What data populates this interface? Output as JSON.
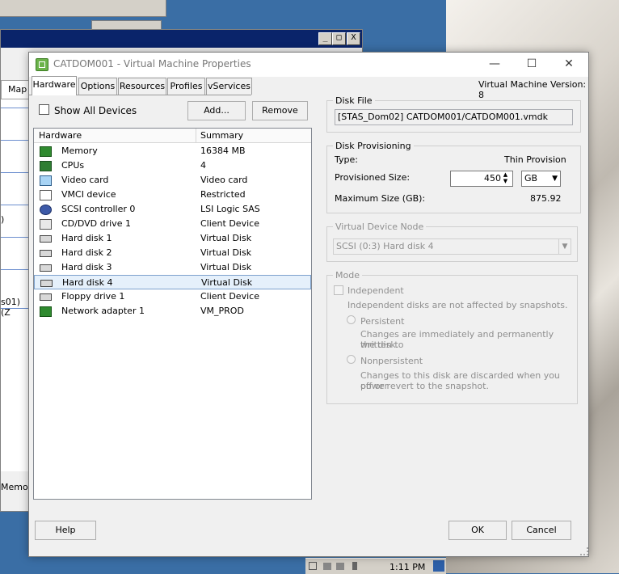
{
  "behind_window": {
    "tab_label": "Map r",
    "row_fragment_1": ")",
    "row_fragment_2": "s01) (Z",
    "status_fragment": "Memory",
    "minimize_glyph": "_",
    "maximize_glyph": "□",
    "close_glyph": "X"
  },
  "taskbar": {
    "time": "1:11 PM"
  },
  "dialog": {
    "title": "CATDOM001 - Virtual Machine Properties",
    "minimize_glyph": "—",
    "maximize_glyph": "☐",
    "close_glyph": "✕",
    "tabs": [
      "Hardware",
      "Options",
      "Resources",
      "Profiles",
      "vServices"
    ],
    "vm_version": "Virtual Machine Version: 8",
    "show_all_devices_label": "Show All Devices",
    "add_button": "Add...",
    "remove_button": "Remove",
    "table_headers": {
      "hardware": "Hardware",
      "summary": "Summary"
    },
    "hardware_rows": [
      {
        "name": "Memory",
        "summary": "16384 MB",
        "icon": "memory-icon"
      },
      {
        "name": "CPUs",
        "summary": "4",
        "icon": "cpu-icon"
      },
      {
        "name": "Video card",
        "summary": "Video card",
        "icon": "video-card-icon"
      },
      {
        "name": "VMCI device",
        "summary": "Restricted",
        "icon": "vmci-icon"
      },
      {
        "name": "SCSI controller 0",
        "summary": "LSI Logic SAS",
        "icon": "scsi-controller-icon"
      },
      {
        "name": "CD/DVD drive 1",
        "summary": "Client Device",
        "icon": "cd-dvd-icon"
      },
      {
        "name": "Hard disk 1",
        "summary": "Virtual Disk",
        "icon": "hard-disk-icon"
      },
      {
        "name": "Hard disk 2",
        "summary": "Virtual Disk",
        "icon": "hard-disk-icon"
      },
      {
        "name": "Hard disk 3",
        "summary": "Virtual Disk",
        "icon": "hard-disk-icon"
      },
      {
        "name": "Hard disk 4",
        "summary": "Virtual Disk",
        "icon": "hard-disk-icon",
        "selected": true
      },
      {
        "name": "Floppy drive 1",
        "summary": "Client Device",
        "icon": "floppy-icon"
      },
      {
        "name": "Network adapter 1",
        "summary": "VM_PROD",
        "icon": "network-adapter-icon"
      }
    ],
    "disk_file": {
      "title": "Disk File",
      "path": "[STAS_Dom02] CATDOM001/CATDOM001.vmdk"
    },
    "disk_provisioning": {
      "title": "Disk Provisioning",
      "type_label": "Type:",
      "type_value": "Thin Provision",
      "size_label": "Provisioned Size:",
      "size_value": "450",
      "unit_value": "GB",
      "max_label": "Maximum Size (GB):",
      "max_value": "875.92"
    },
    "virtual_device_node": {
      "title": "Virtual Device Node",
      "value": "SCSI (0:3) Hard disk 4"
    },
    "mode": {
      "title": "Mode",
      "independent_label": "Independent",
      "independent_desc": "Independent disks are not affected by snapshots.",
      "persistent_label": "Persistent",
      "persistent_desc_1": "Changes are immediately and permanently written to",
      "persistent_desc_2": "the disk.",
      "nonpersistent_label": "Nonpersistent",
      "nonpersistent_desc_1": "Changes to this disk are discarded when you power",
      "nonpersistent_desc_2": "off or revert to the snapshot."
    },
    "help_button": "Help",
    "ok_button": "OK",
    "cancel_button": "Cancel"
  }
}
